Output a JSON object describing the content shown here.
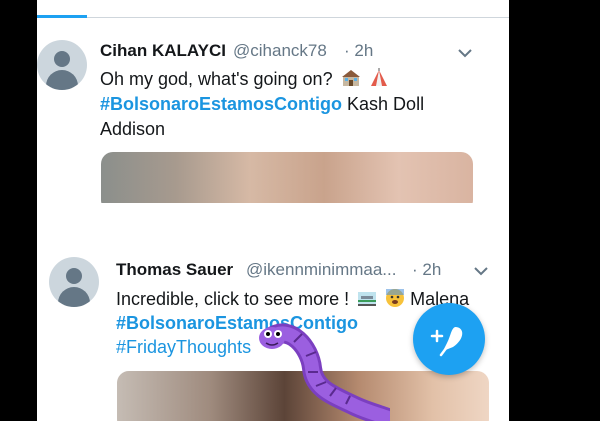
{
  "colors": {
    "accent": "#1da1f2",
    "hashtag": "#1b95e0",
    "background": "#000000"
  },
  "tweets": [
    {
      "display_name": "Cihan KALAYCI",
      "handle": "@cihanck78",
      "time": "· 2h",
      "text": "Oh my god, what's going on?",
      "emojis": [
        "school-emoji",
        "circus-tent-emoji"
      ],
      "hashtags": [
        "#BolsonaroEstamosContigo"
      ],
      "extra_text": " Kash Doll",
      "line3": "Addison"
    },
    {
      "display_name": "Thomas Sauer",
      "handle": "@ikennminimmaa...",
      "time": "· 2h",
      "text": "Incredible, click to see more !",
      "emojis": [
        "railway-emoji",
        "anxious-face-emoji"
      ],
      "extra_text": " Malena",
      "hashtags": [
        "#BolsonaroEstamosContigo",
        "#FridayThoughts"
      ]
    }
  ],
  "fab": {
    "icon": "compose-feather-icon"
  },
  "overlay": {
    "icon": "purple-worm-sticker"
  }
}
